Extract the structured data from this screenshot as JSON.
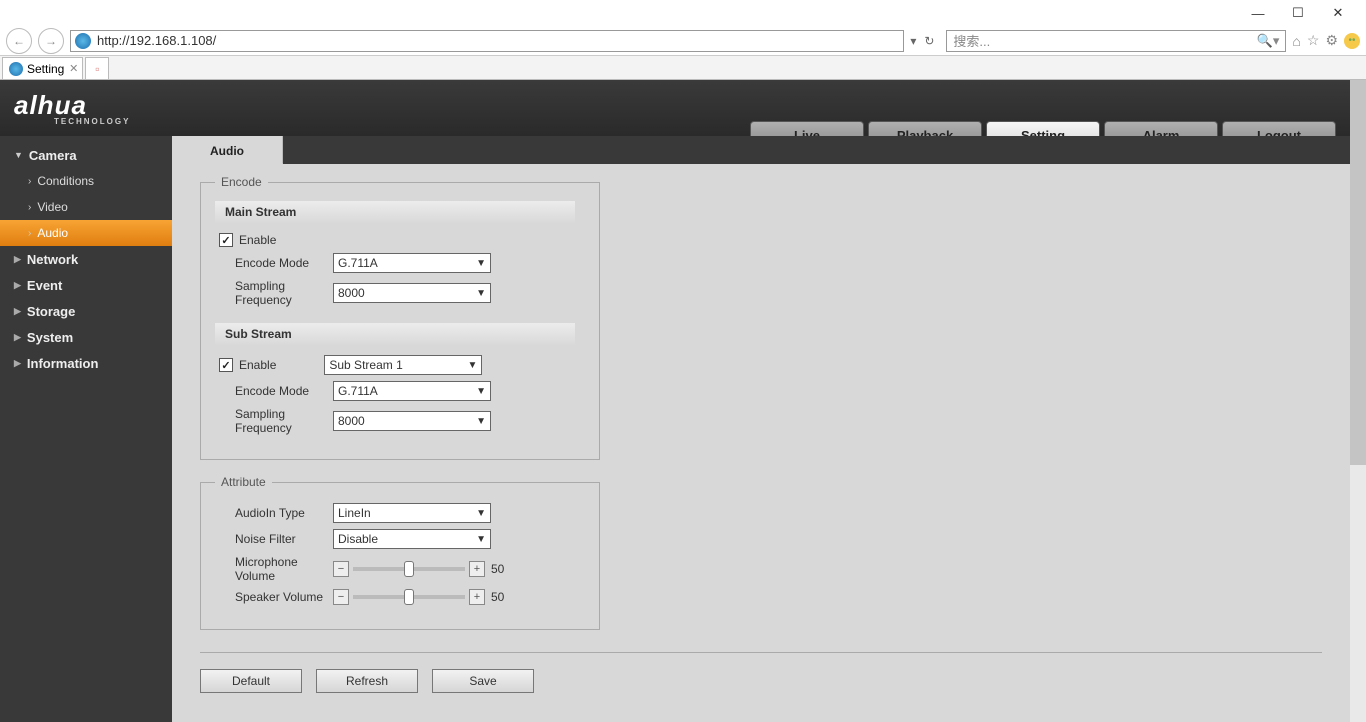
{
  "browser": {
    "url": "http://192.168.1.108/",
    "search_placeholder": "搜索...",
    "tab_title": "Setting"
  },
  "header": {
    "logo_main": "alhua",
    "logo_sub": "TECHNOLOGY",
    "tabs": {
      "live": "Live",
      "playback": "Playback",
      "setting": "Setting",
      "alarm": "Alarm",
      "logout": "Logout"
    }
  },
  "sidebar": {
    "camera": "Camera",
    "conditions": "Conditions",
    "video": "Video",
    "audio": "Audio",
    "network": "Network",
    "event": "Event",
    "storage": "Storage",
    "system": "System",
    "information": "Information"
  },
  "content": {
    "tab": "Audio",
    "encode": {
      "legend": "Encode",
      "main_stream": "Main Stream",
      "sub_stream": "Sub Stream",
      "enable": "Enable",
      "encode_mode": "Encode Mode",
      "sampling": "Sampling Frequency",
      "main_enable_checked": "✓",
      "main_mode_value": "G.711A",
      "main_sampling_value": "8000",
      "sub_enable_checked": "✓",
      "sub_select_value": "Sub Stream 1",
      "sub_mode_value": "G.711A",
      "sub_sampling_value": "8000"
    },
    "attribute": {
      "legend": "Attribute",
      "audioin_type": "AudioIn Type",
      "audioin_value": "LineIn",
      "noise_filter": "Noise Filter",
      "noise_value": "Disable",
      "mic_volume": "Microphone Volume",
      "mic_value": "50",
      "speaker_volume": "Speaker Volume",
      "speaker_value": "50"
    },
    "buttons": {
      "default": "Default",
      "refresh": "Refresh",
      "save": "Save"
    }
  }
}
